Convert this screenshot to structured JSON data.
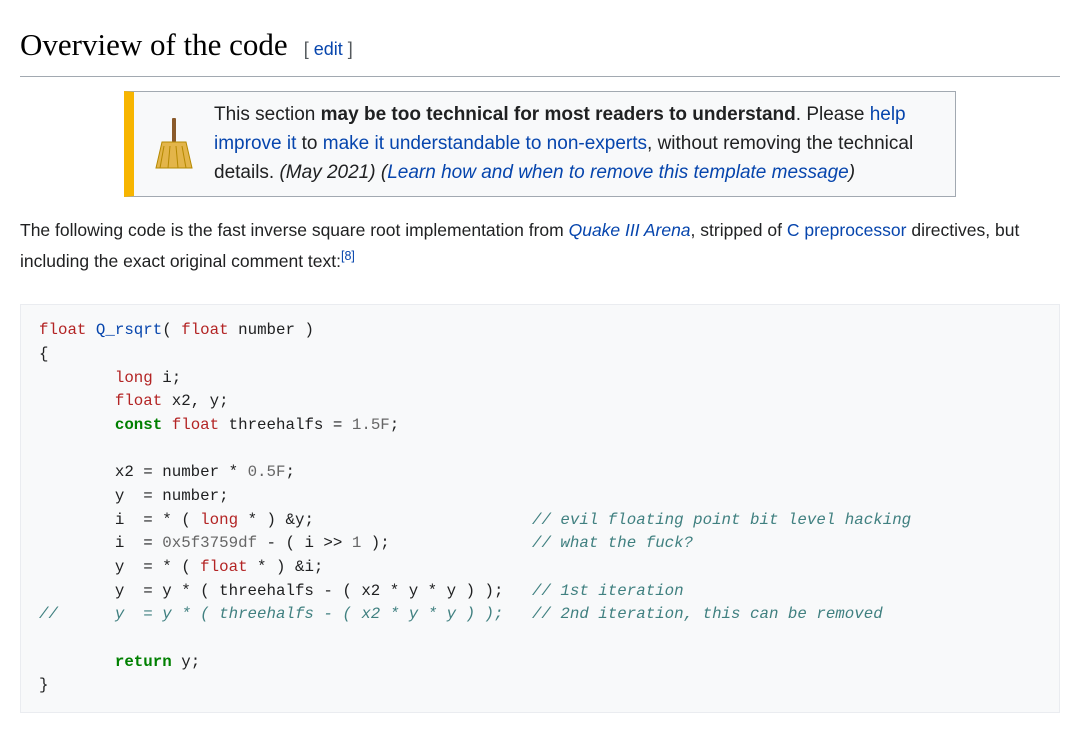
{
  "section": {
    "heading": "Overview of the code",
    "edit_open": "[ ",
    "edit_label": "edit",
    "edit_close": " ]"
  },
  "ambox": {
    "icon_name": "broom-icon",
    "t1": "This section ",
    "t2_bold": "may be too technical for most readers to understand",
    "t3": ". Please ",
    "link_help": "help improve it",
    "t4": " to ",
    "link_nonexp": "make it understandable to non-experts",
    "t5": ", without removing the technical details. ",
    "date_italic": "(May 2021)",
    "t6_open": " (",
    "link_learn": "Learn how and when to remove this template message",
    "t6_close": ")"
  },
  "intro": {
    "p1": "The following code is the fast inverse square root implementation from ",
    "link_quake": "Quake III Arena",
    "p2": ", stripped of ",
    "link_cpre": "C preprocessor",
    "p3": " directives, but including the exact original comment text:",
    "ref_label": "[8]"
  },
  "code": {
    "l1": {
      "a": "float",
      "b": " ",
      "fn": "Q_rsqrt",
      "c": "( ",
      "d": "float",
      "e": " number )"
    },
    "l2": "{",
    "l3": {
      "pad": "\t",
      "a": "long",
      "b": " i;"
    },
    "l4": {
      "pad": "\t",
      "a": "float",
      "b": " x2, y;"
    },
    "l5": {
      "pad": "\t",
      "a": "const",
      "b": " ",
      "c": "float",
      "d": " threehalfs = ",
      "n": "1.5F",
      "e": ";"
    },
    "l6": "",
    "l7": {
      "pad": "\t",
      "a": "x2 = number * ",
      "n": "0.5F",
      "b": ";"
    },
    "l8": {
      "pad": "\t",
      "a": "y  = number;"
    },
    "l9": {
      "pad": "\t",
      "a": "i  = * ( ",
      "t": "long",
      "b": " * ) &y;                       ",
      "c": "// evil floating point bit level hacking"
    },
    "l10": {
      "pad": "\t",
      "a": "i  = ",
      "n": "0x5f3759df",
      "b": " - ( i >> ",
      "n2": "1",
      "c": " );               ",
      "cm": "// what the fuck? "
    },
    "l11": {
      "pad": "\t",
      "a": "y  = * ( ",
      "t": "float",
      "b": " * ) &i;"
    },
    "l12": {
      "pad": "\t",
      "a": "y  = y * ( threehalfs - ( x2 * y * y ) );   ",
      "cm": "// 1st iteration"
    },
    "l13": {
      "cm": "//\ty  = y * ( threehalfs - ( x2 * y * y ) );   // 2nd iteration, this can be removed"
    },
    "l14": "",
    "l15": {
      "pad": "\t",
      "a": "return",
      "b": " y;"
    },
    "l16": "}"
  }
}
